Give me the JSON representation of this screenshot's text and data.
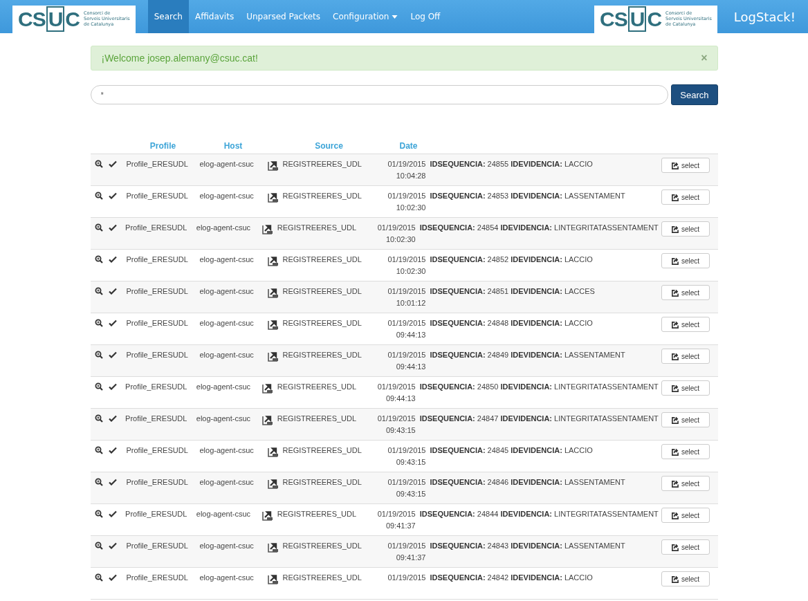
{
  "navbar": {
    "logo": {
      "mark_left": "CS",
      "mark_box": "U",
      "mark_right": "C",
      "lines": [
        "Consorci de",
        "Serveis Universitaris",
        "de Catalunya"
      ]
    },
    "items": [
      {
        "label": "Search",
        "selected": true,
        "kind": "link"
      },
      {
        "label": "Affidavits",
        "selected": false,
        "kind": "link"
      },
      {
        "label": "Unparsed Packets",
        "selected": false,
        "kind": "link"
      },
      {
        "label": "Configuration",
        "selected": false,
        "kind": "dropdown"
      },
      {
        "label": "Log Off",
        "selected": false,
        "kind": "link"
      }
    ],
    "right_logo": {
      "mark_left": "CS",
      "mark_box": "U",
      "mark_right": "C",
      "lines": [
        "Consorci de",
        "Serveis Universitaris",
        "de Catalunya"
      ]
    },
    "brand": "LogStack!"
  },
  "alert": {
    "text": "¡Welcome josep.alemany@csuc.cat!",
    "close": "×"
  },
  "search": {
    "value": "*",
    "button": "Search"
  },
  "table": {
    "columns": [
      "Profile",
      "Host",
      "Source",
      "Date"
    ],
    "rows": [
      {
        "profile": "Profile_ERESUDL",
        "host": "elog-agent-csuc",
        "source": "REGISTREERES_UDL",
        "date": "01/19/2015",
        "time": "10:04:28",
        "details": "**IDSEQUENCIA:** 24855 **IDEVIDENCIA:** LACCIO",
        "action": "select"
      },
      {
        "profile": "Profile_ERESUDL",
        "host": "elog-agent-csuc",
        "source": "REGISTREERES_UDL",
        "date": "01/19/2015",
        "time": "10:02:30",
        "details": "**IDSEQUENCIA:** 24853 **IDEVIDENCIA:** LASSENTAMENT",
        "action": "select"
      },
      {
        "profile": "Profile_ERESUDL",
        "host": "elog-agent-csuc",
        "source": "REGISTREERES_UDL",
        "date": "01/19/2015",
        "time": "10:02:30",
        "details": "**IDSEQUENCIA:** 24854 **IDEVIDENCIA:** LINTEGRITATASSENTAMENT",
        "action": "select"
      },
      {
        "profile": "Profile_ERESUDL",
        "host": "elog-agent-csuc",
        "source": "REGISTREERES_UDL",
        "date": "01/19/2015",
        "time": "10:02:30",
        "details": "**IDSEQUENCIA:** 24852 **IDEVIDENCIA:** LACCIO",
        "action": "select"
      },
      {
        "profile": "Profile_ERESUDL",
        "host": "elog-agent-csuc",
        "source": "REGISTREERES_UDL",
        "date": "01/19/2015",
        "time": "10:01:12",
        "details": "**IDSEQUENCIA:** 24851 **IDEVIDENCIA:** LACCES",
        "action": "select"
      },
      {
        "profile": "Profile_ERESUDL",
        "host": "elog-agent-csuc",
        "source": "REGISTREERES_UDL",
        "date": "01/19/2015",
        "time": "09:44:13",
        "details": "**IDSEQUENCIA:** 24848 **IDEVIDENCIA:** LACCIO",
        "action": "select"
      },
      {
        "profile": "Profile_ERESUDL",
        "host": "elog-agent-csuc",
        "source": "REGISTREERES_UDL",
        "date": "01/19/2015",
        "time": "09:44:13",
        "details": "**IDSEQUENCIA:** 24849 **IDEVIDENCIA:** LASSENTAMENT",
        "action": "select"
      },
      {
        "profile": "Profile_ERESUDL",
        "host": "elog-agent-csuc",
        "source": "REGISTREERES_UDL",
        "date": "01/19/2015",
        "time": "09:44:13",
        "details": "**IDSEQUENCIA:** 24850 **IDEVIDENCIA:** LINTEGRITATASSENTAMENT",
        "action": "select"
      },
      {
        "profile": "Profile_ERESUDL",
        "host": "elog-agent-csuc",
        "source": "REGISTREERES_UDL",
        "date": "01/19/2015",
        "time": "09:43:15",
        "details": "**IDSEQUENCIA:** 24847 **IDEVIDENCIA:** LINTEGRITATASSENTAMENT",
        "action": "select"
      },
      {
        "profile": "Profile_ERESUDL",
        "host": "elog-agent-csuc",
        "source": "REGISTREERES_UDL",
        "date": "01/19/2015",
        "time": "09:43:15",
        "details": "**IDSEQUENCIA:** 24845 **IDEVIDENCIA:** LACCIO",
        "action": "select"
      },
      {
        "profile": "Profile_ERESUDL",
        "host": "elog-agent-csuc",
        "source": "REGISTREERES_UDL",
        "date": "01/19/2015",
        "time": "09:43:15",
        "details": "**IDSEQUENCIA:** 24846 **IDEVIDENCIA:** LASSENTAMENT",
        "action": "select"
      },
      {
        "profile": "Profile_ERESUDL",
        "host": "elog-agent-csuc",
        "source": "REGISTREERES_UDL",
        "date": "01/19/2015",
        "time": "09:41:37",
        "details": "**IDSEQUENCIA:** 24844 **IDEVIDENCIA:** LINTEGRITATASSENTAMENT",
        "action": "select"
      },
      {
        "profile": "Profile_ERESUDL",
        "host": "elog-agent-csuc",
        "source": "REGISTREERES_UDL",
        "date": "01/19/2015",
        "time": "09:41:37",
        "details": "**IDSEQUENCIA:** 24843 **IDEVIDENCIA:** LASSENTAMENT",
        "action": "select"
      },
      {
        "profile": "Profile_ERESUDL",
        "host": "elog-agent-csuc",
        "source": "REGISTREERES_UDL",
        "date": "01/19/2015",
        "details": "**IDSEQUENCIA:** 24842 **IDEVIDENCIA:** LACCIO",
        "action": "select"
      }
    ]
  }
}
